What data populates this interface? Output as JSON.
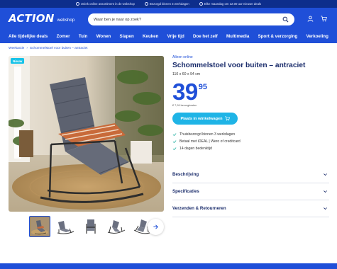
{
  "topbar": {
    "usps": [
      "Uniek online assortiment in de webshop",
      "Bezorgd binnen 3 werkdagen",
      "Elke maandag om 12.00 uur nieuwe deals"
    ]
  },
  "header": {
    "logo": "ACTION",
    "logo_sub": "webshop",
    "search_placeholder": "Waar ben je naar op zoek?",
    "icons": [
      "search-icon",
      "account-icon",
      "cart-icon"
    ]
  },
  "nav": {
    "items": [
      "Alle tijdelijke deals",
      "Zomer",
      "Tuin",
      "Wonen",
      "Slapen",
      "Keuken",
      "Vrije tijd",
      "Doe het zelf",
      "Multimedia",
      "Sport & verzorging",
      "Verkoeling"
    ]
  },
  "breadcrumb": {
    "root": "Weekactie",
    "separator": "›",
    "current": "Schommelstoel voor buiten – antraciet"
  },
  "product": {
    "badge": "Nieuw",
    "availability": "Alleen online",
    "title": "Schommelstoel voor buiten – antraciet",
    "dimensions": "110 x 60 x 94 cm",
    "price_int": "39",
    "price_dec": "95",
    "deposit": "€ 7,99 bezorgkosten",
    "cta": "Plaats in winkelwagen",
    "usps": [
      "Thuisbezorgd binnen 3 werkdagen",
      "Betaal met iDEAL | Wero of creditcard",
      "14 dagen bedenktijd"
    ],
    "accordion": [
      "Beschrijving",
      "Specificaties",
      "Verzenden & Retourneren"
    ]
  },
  "colors": {
    "brand_blue": "#1f4fd8",
    "dark_blue": "#0d2e8c",
    "cta_cyan": "#1fb4e6",
    "badge_cyan": "#16c2e8",
    "check_green": "#2bb3a6"
  }
}
